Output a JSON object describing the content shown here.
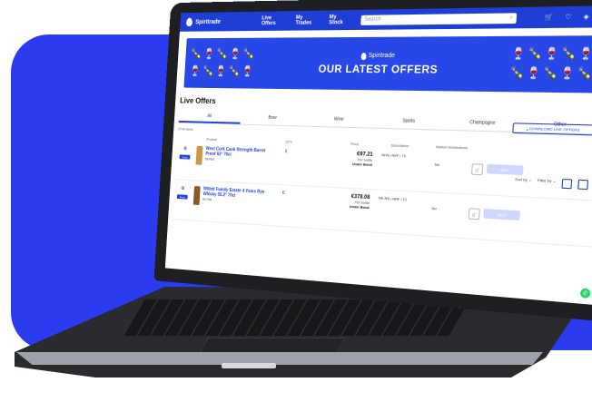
{
  "nav": {
    "brand": "Spiritrade",
    "links": [
      "Live Offers",
      "My Trades",
      "My Stock"
    ],
    "search_placeholder": "Search"
  },
  "banner": {
    "brand": "Spiritrade",
    "title": "OUR LATEST OFFERS"
  },
  "page": {
    "heading": "Live Offers",
    "download_button": "DOWNLOAD LIVE OFFERS",
    "tabs": [
      "All",
      "Beer",
      "Wine",
      "Spirits",
      "Champagne",
      "Other"
    ],
    "items_count": "2749 Items",
    "sort_label": "Sort by",
    "filter_label": "Filter by"
  },
  "table": {
    "headers": [
      "Product",
      "QTY",
      "Price",
      "Description",
      "Market Restrictions"
    ],
    "rows": [
      {
        "name": "West Cork Cask Strength Barrel Proof 62° 70cl",
        "meta": "5x70cl",
        "badge": "Stock",
        "qty": "6",
        "price": "€97.21",
        "price_sub": "Per bottle",
        "price_note": "Under Bond",
        "description": "RFN / REF / T2",
        "market": "No",
        "buy": "BUY"
      },
      {
        "name": "Willett Family Estate 4 Years Rye Whisky 55.2° 70cl",
        "meta": "6x70cl",
        "badge": "Stock",
        "qty": "6",
        "price": "€378.08",
        "price_sub": "Per bottle",
        "price_note": "Under Bond",
        "description": "RE-RS / NRF / T2",
        "market": "No",
        "buy": "BUY"
      }
    ]
  },
  "colors": {
    "brand_blue": "#1f3ed6",
    "background_blob": "#2b3cf0",
    "whatsapp": "#25d366"
  }
}
